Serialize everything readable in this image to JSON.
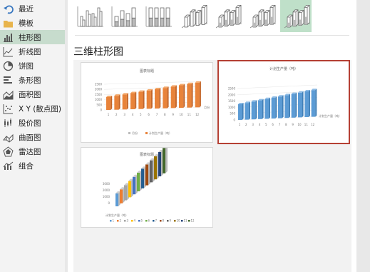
{
  "sidebar": {
    "items": [
      {
        "label": "最近",
        "icon": "undo-arrow-icon"
      },
      {
        "label": "模板",
        "icon": "folder-icon"
      },
      {
        "label": "柱形图",
        "icon": "column-chart-icon",
        "selected": true
      },
      {
        "label": "折线图",
        "icon": "line-chart-icon"
      },
      {
        "label": "饼图",
        "icon": "pie-chart-icon"
      },
      {
        "label": "条形图",
        "icon": "bar-chart-icon"
      },
      {
        "label": "面积图",
        "icon": "area-chart-icon"
      },
      {
        "label": "X Y (散点图)",
        "icon": "scatter-chart-icon"
      },
      {
        "label": "股价图",
        "icon": "stock-chart-icon"
      },
      {
        "label": "曲面图",
        "icon": "surface-chart-icon"
      },
      {
        "label": "雷达图",
        "icon": "radar-chart-icon"
      },
      {
        "label": "组合",
        "icon": "combo-chart-icon"
      }
    ]
  },
  "subtypes": [
    {
      "name": "clustered-column",
      "selected": false
    },
    {
      "name": "stacked-column",
      "selected": false
    },
    {
      "name": "100-stacked-column",
      "selected": false
    },
    {
      "name": "3d-clustered-column",
      "selected": false
    },
    {
      "name": "3d-stacked-column",
      "selected": false
    },
    {
      "name": "3d-100-stacked-column",
      "selected": false
    },
    {
      "name": "3d-column",
      "selected": true
    }
  ],
  "section_title": "三维柱形图",
  "thumbs": {
    "t1": {
      "title": "图表标题",
      "xlabel": "月份",
      "legend": [
        "月份",
        "计划生产量（吨）"
      ],
      "ylabels": [
        "2500",
        "2000",
        "1500",
        "1000",
        "500",
        "0"
      ],
      "categories": [
        "1",
        "2",
        "3",
        "4",
        "5",
        "6",
        "7",
        "8",
        "9",
        "10",
        "11",
        "12"
      ]
    },
    "t2": {
      "title": "计划生产量（吨）",
      "xlabel": "计划生产量（吨）",
      "ylabels": [
        "2500",
        "2000",
        "1500",
        "1000",
        "500",
        "0"
      ],
      "categories": [
        "1",
        "2",
        "3",
        "4",
        "5",
        "6",
        "7",
        "8",
        "9",
        "10",
        "11",
        "12"
      ]
    },
    "t3": {
      "title": "图表标题",
      "ylabels": [
        "3000",
        "2000",
        "1000",
        "0"
      ],
      "legend": [
        "1",
        "2",
        "3",
        "4",
        "5",
        "6",
        "7",
        "8",
        "9",
        "10",
        "11",
        "12"
      ],
      "axis_label": "计划生产量（吨）"
    }
  },
  "colors": {
    "accent_green": "#c7dccd",
    "selection_border": "#b54034",
    "orange_bar": "#e8833a",
    "blue_bar": "#5b9bd5"
  }
}
